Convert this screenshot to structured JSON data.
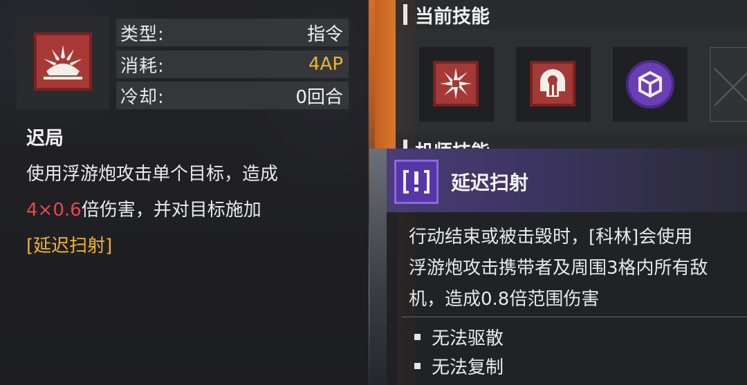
{
  "skill": {
    "icon": "shield-sunburst-icon",
    "stats": [
      {
        "label": "类型:",
        "value": "指令"
      },
      {
        "label": "消耗:",
        "value": "4AP"
      },
      {
        "label": "冷却:",
        "value": "0回合"
      }
    ],
    "name": "迟局",
    "desc_part1": "使用浮游炮攻击单个目标，造成",
    "desc_dmg": "4×0.6",
    "desc_part2": "倍伤害，并对目标施加",
    "desc_status": "[延迟扫射]"
  },
  "current_skills": {
    "header": "当前技能",
    "slots": [
      {
        "icon": "crosshair-burst-icon"
      },
      {
        "icon": "helmet-icon"
      },
      {
        "icon": "cube-icon"
      },
      {
        "icon": "empty-slot-icon"
      }
    ]
  },
  "machine_skills": {
    "header": "机师技能"
  },
  "status_effect": {
    "icon": "warning-bracket-icon",
    "title": "延迟扫射",
    "desc_lines": [
      "行动结束或被击毁时，[科林]会使用",
      "浮游炮攻击携带者及周围3格内所有敌",
      "机，造成0.8倍范围伤害"
    ],
    "tags": [
      "无法驱散",
      "无法复制"
    ]
  },
  "colors": {
    "cost": "#f0b52c",
    "damage": "#e84848",
    "status_link": "#f0b52c",
    "skill_red": "#a73a37",
    "status_purple": "#5636a8"
  }
}
